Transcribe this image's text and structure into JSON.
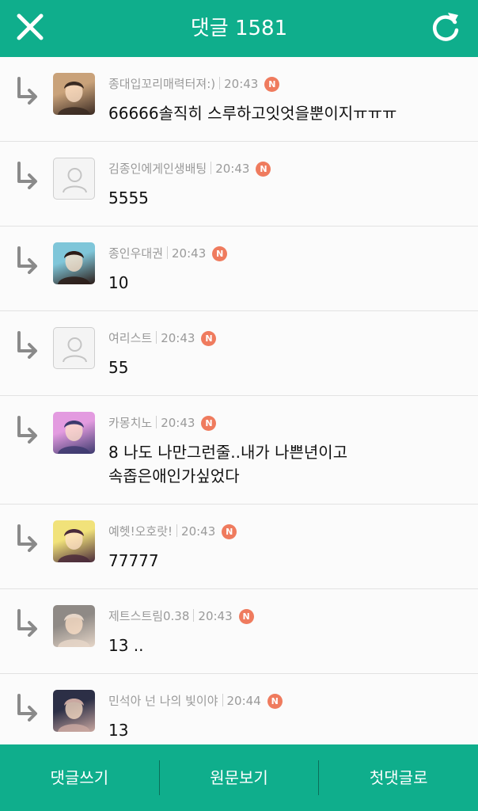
{
  "header": {
    "title": "댓글 1581",
    "close_icon": "close-icon",
    "refresh_icon": "refresh-icon",
    "background": "#0fae8c"
  },
  "comments": [
    {
      "author": "종대입꼬리매력터져:)",
      "time": "20:43",
      "badge": "N",
      "text": "66666솔직히 스루하고잇엇을뿐이지ㅠㅠㅠ",
      "avatar": "photo",
      "avatar_colors": [
        "#c9a27a",
        "#3a2a22"
      ]
    },
    {
      "author": "김종인에게인생배팅",
      "time": "20:43",
      "badge": "N",
      "text": "5555",
      "avatar": "default"
    },
    {
      "author": "종인우대권",
      "time": "20:43",
      "badge": "N",
      "text": "10",
      "avatar": "photo",
      "avatar_colors": [
        "#7fc6d9",
        "#2b1b16"
      ]
    },
    {
      "author": "여리스트",
      "time": "20:43",
      "badge": "N",
      "text": "55",
      "avatar": "default"
    },
    {
      "author": "카몽치노",
      "time": "20:43",
      "badge": "N",
      "text": "8 나도 나만그런줄..내가 나쁜년이고\n속좁은애인가싶었다",
      "avatar": "photo",
      "avatar_colors": [
        "#e39be0",
        "#3d3a6e"
      ]
    },
    {
      "author": "예헷!오호랏!",
      "time": "20:43",
      "badge": "N",
      "text": "77777",
      "avatar": "photo",
      "avatar_colors": [
        "#f1e27a",
        "#4a2a3a"
      ]
    },
    {
      "author": "제트스트림0.38",
      "time": "20:43",
      "badge": "N",
      "text": "13 ..",
      "avatar": "photo",
      "avatar_colors": [
        "#8f8a86",
        "#e6d6c8"
      ]
    },
    {
      "author": "민석아 넌 나의 빛이야",
      "time": "20:44",
      "badge": "N",
      "text": "13",
      "avatar": "photo",
      "avatar_colors": [
        "#2c2f46",
        "#c9a7a0"
      ]
    }
  ],
  "footer": {
    "write_comment": "댓글쓰기",
    "view_original": "원문보기",
    "first_comment": "첫댓글로"
  },
  "colors": {
    "accent": "#0fae8c",
    "badge": "#ef7b5e",
    "meta_text": "#9a9a9a"
  }
}
